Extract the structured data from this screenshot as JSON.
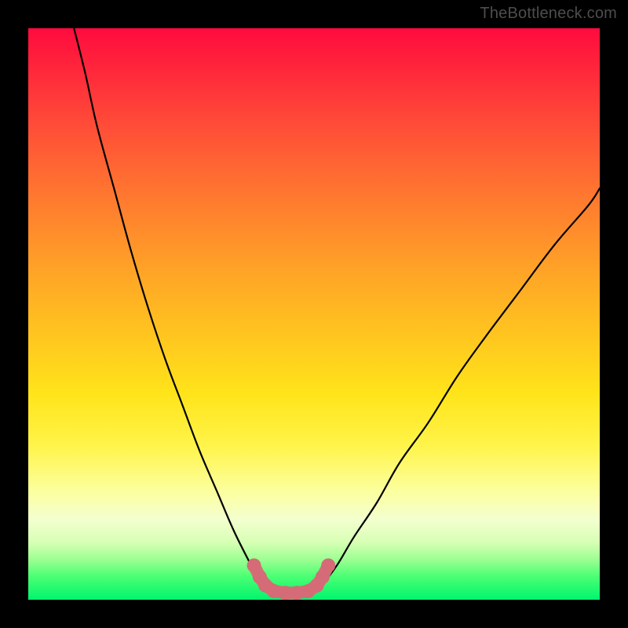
{
  "watermark": "TheBottleneck.com",
  "palette": {
    "curve_stroke": "#000000",
    "marker_fill": "#d46b76",
    "marker_stroke": "#d46b76",
    "background": "#000000"
  },
  "chart_data": {
    "type": "line",
    "title": "",
    "xlabel": "",
    "ylabel": "",
    "xlim": [
      0,
      100
    ],
    "ylim": [
      0,
      100
    ],
    "grid": false,
    "legend": false,
    "note": "No axes, ticks, or numeric labels are rendered. Values below are relative percentages (0–100) estimated from pixel position, with y=100 at the top of the plot and y=0 at the bottom.",
    "series": [
      {
        "name": "left-branch",
        "style": "line",
        "x": [
          8,
          10,
          12,
          15,
          18,
          21,
          24,
          27,
          30,
          33,
          36,
          39,
          41
        ],
        "y": [
          100,
          92,
          83,
          72,
          61,
          51,
          42,
          34,
          26,
          19,
          12,
          6,
          2
        ]
      },
      {
        "name": "right-branch",
        "style": "line",
        "x": [
          51,
          54,
          57,
          61,
          65,
          70,
          75,
          80,
          86,
          92,
          98,
          100
        ],
        "y": [
          2,
          6,
          11,
          17,
          24,
          31,
          39,
          46,
          54,
          62,
          69,
          72
        ]
      },
      {
        "name": "bottleneck-markers",
        "style": "marker",
        "x": [
          39.5,
          40.5,
          41.5,
          43.0,
          45.0,
          47.0,
          49.0,
          50.5,
          51.5,
          52.5
        ],
        "y": [
          6.0,
          4.0,
          2.5,
          1.5,
          1.2,
          1.2,
          1.5,
          2.5,
          4.0,
          6.0
        ]
      }
    ]
  }
}
